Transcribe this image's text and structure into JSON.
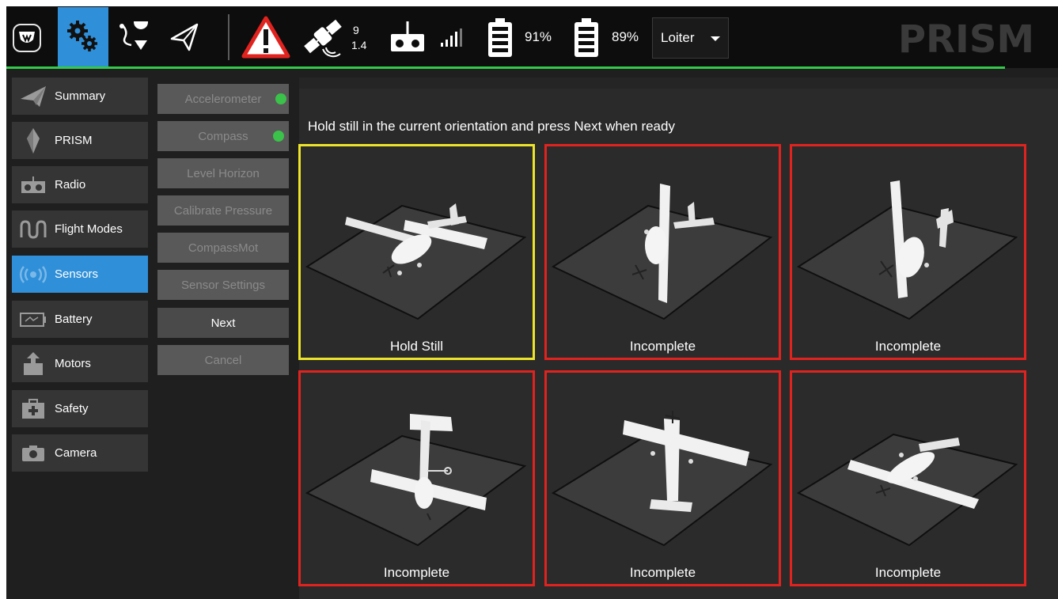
{
  "toolbar": {
    "gps_sat_count": "9",
    "gps_hdop": "1.4",
    "battery1_percent": "91%",
    "battery2_percent": "89%",
    "flight_mode": "Loiter",
    "brand": "PRISM",
    "accent_color": "#2f8fd8",
    "status_line_color": "#33c94a"
  },
  "nav": {
    "items": [
      {
        "label": "Summary",
        "icon": "paper-plane-icon"
      },
      {
        "label": "PRISM",
        "icon": "prism-icon"
      },
      {
        "label": "Radio",
        "icon": "radio-icon"
      },
      {
        "label": "Flight Modes",
        "icon": "flight-modes-icon"
      },
      {
        "label": "Sensors",
        "icon": "sensors-icon",
        "active": true
      },
      {
        "label": "Battery",
        "icon": "battery-icon"
      },
      {
        "label": "Motors",
        "icon": "motors-icon"
      },
      {
        "label": "Safety",
        "icon": "first-aid-icon"
      },
      {
        "label": "Camera",
        "icon": "camera-icon"
      }
    ]
  },
  "sensors_menu": {
    "items": [
      {
        "label": "Accelerometer",
        "status": "ok"
      },
      {
        "label": "Compass",
        "status": "ok"
      },
      {
        "label": "Level Horizon"
      },
      {
        "label": "Calibrate Pressure"
      },
      {
        "label": "CompassMot"
      },
      {
        "label": "Sensor Settings"
      }
    ],
    "next_label": "Next",
    "cancel_label": "Cancel"
  },
  "calibration": {
    "instruction": "Hold still in the current orientation and press Next when ready",
    "tiles": [
      {
        "label": "Hold Still",
        "state": "current"
      },
      {
        "label": "Incomplete",
        "state": "incomplete"
      },
      {
        "label": "Incomplete",
        "state": "incomplete"
      },
      {
        "label": "Incomplete",
        "state": "incomplete"
      },
      {
        "label": "Incomplete",
        "state": "incomplete"
      },
      {
        "label": "Incomplete",
        "state": "incomplete"
      }
    ],
    "colors": {
      "current": "#ece42a",
      "incomplete": "#e0231f"
    }
  }
}
